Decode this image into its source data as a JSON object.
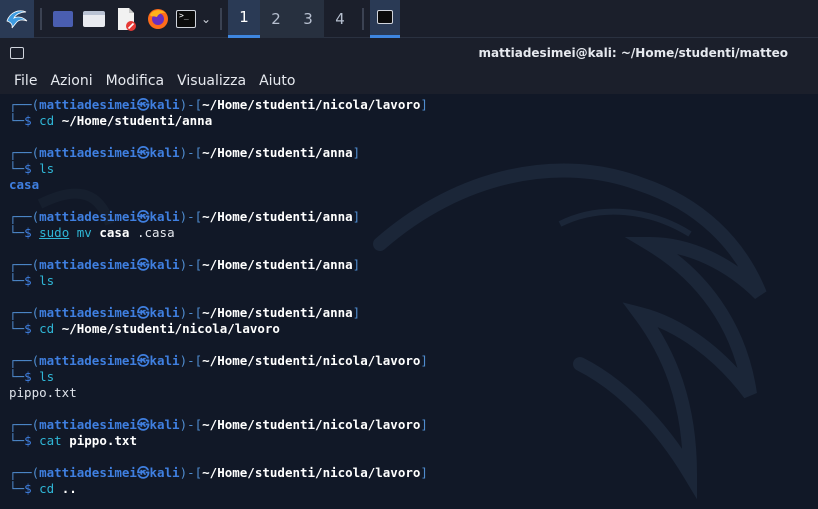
{
  "taskbar": {
    "workspaces": [
      "1",
      "2",
      "3",
      "4"
    ],
    "icons": [
      "kali-menu-icon",
      "show-desktop-icon",
      "file-manager-icon",
      "text-editor-icon",
      "firefox-icon",
      "terminal-icon",
      "chevron-down-icon",
      "terminal-window-icon"
    ]
  },
  "window": {
    "title": "mattiadesimei@kali: ~/Home/studenti/matteo"
  },
  "menu": [
    "File",
    "Azioni",
    "Modifica",
    "Visualizza",
    "Aiuto"
  ],
  "terminal": {
    "user": "mattiadesimei",
    "host": "kali",
    "blocks": [
      {
        "path": "~/Home/studenti/nicola/lavoro",
        "cmd": "cd",
        "arg": "~/Home/studenti/anna",
        "output": []
      },
      {
        "path": "~/Home/studenti/anna",
        "cmd": "ls",
        "arg": "",
        "output": [
          {
            "text": "casa",
            "kind": "dir"
          }
        ]
      },
      {
        "path": "~/Home/studenti/anna",
        "cmd": "sudo mv casa .casa",
        "arg": "",
        "output": []
      },
      {
        "path": "~/Home/studenti/anna",
        "cmd": "ls",
        "arg": "",
        "output": []
      },
      {
        "path": "~/Home/studenti/anna",
        "cmd": "cd",
        "arg": "~/Home/studenti/nicola/lavoro",
        "output": []
      },
      {
        "path": "~/Home/studenti/nicola/lavoro",
        "cmd": "ls",
        "arg": "",
        "output": [
          {
            "text": "pippo.txt",
            "kind": "file"
          }
        ]
      },
      {
        "path": "~/Home/studenti/nicola/lavoro",
        "cmd": "cat",
        "arg": "pippo.txt",
        "output": []
      },
      {
        "path": "~/Home/studenti/nicola/lavoro",
        "cmd": "cd",
        "arg": "..",
        "output": []
      }
    ]
  },
  "colors": {
    "accent": "#3f7fe0",
    "command": "#2fb6d6",
    "background": "#111827"
  }
}
